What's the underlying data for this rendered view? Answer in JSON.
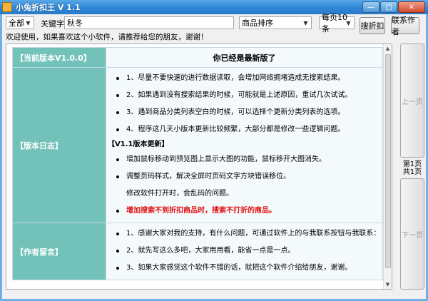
{
  "window": {
    "title": "小兔折扣王 V 1.1"
  },
  "toolbar": {
    "category": "全部",
    "keyword_label": "关键字:",
    "keyword_value": "秋冬",
    "sort": "商品排序",
    "per_page": "每页10条",
    "search_button": "搜折扣",
    "contact_button": "联系作者"
  },
  "welcome": "欢迎使用，如果喜欢这个小软件，请推荐给您的朋友，谢谢！",
  "sections": {
    "version": {
      "header": "【当前版本V1.0.0】",
      "message": "你已经是最新版了"
    },
    "log": {
      "header": "【版本日志】",
      "items": [
        "1、尽量不要快速的进行数据读取，会增加网络拥堵造成无搜索结果。",
        "2、如果遇到没有搜索结果的时候，可能就是上述原因，重试几次试试。",
        "3、遇到商品分类列表空白的时候，可以选择个更新分类列表的选项。",
        "4、程序这几天小版本更新比较频繁，大部分都是修改一些逻辑问题。"
      ],
      "subheader": "【V1.1版本更新】",
      "updates": [
        "增加鼠标移动到预览图上显示大图的功能，鼠标移开大图消失。",
        "调整页码样式，解决全屏时页码文字方块错误移位。",
        "修改软件打开时，会乱码的问题。",
        "增加搜索不到折扣商品时，搜索不打折的商品。"
      ]
    },
    "author": {
      "header": "【作者留言】",
      "items": [
        "1、感谢大家对我的支持，有什么问题，可通过软件上的与我联系按钮与我联系：",
        "2、就先写这么多吧，大家用用看，能省一点是一点。",
        "3、如果大家感觉这个软件不错的话，就把这个软件介绍给朋友，谢谢。"
      ]
    }
  },
  "pager": {
    "prev": "上一页",
    "next": "下一页",
    "page": "第1页",
    "total": "共1页"
  }
}
